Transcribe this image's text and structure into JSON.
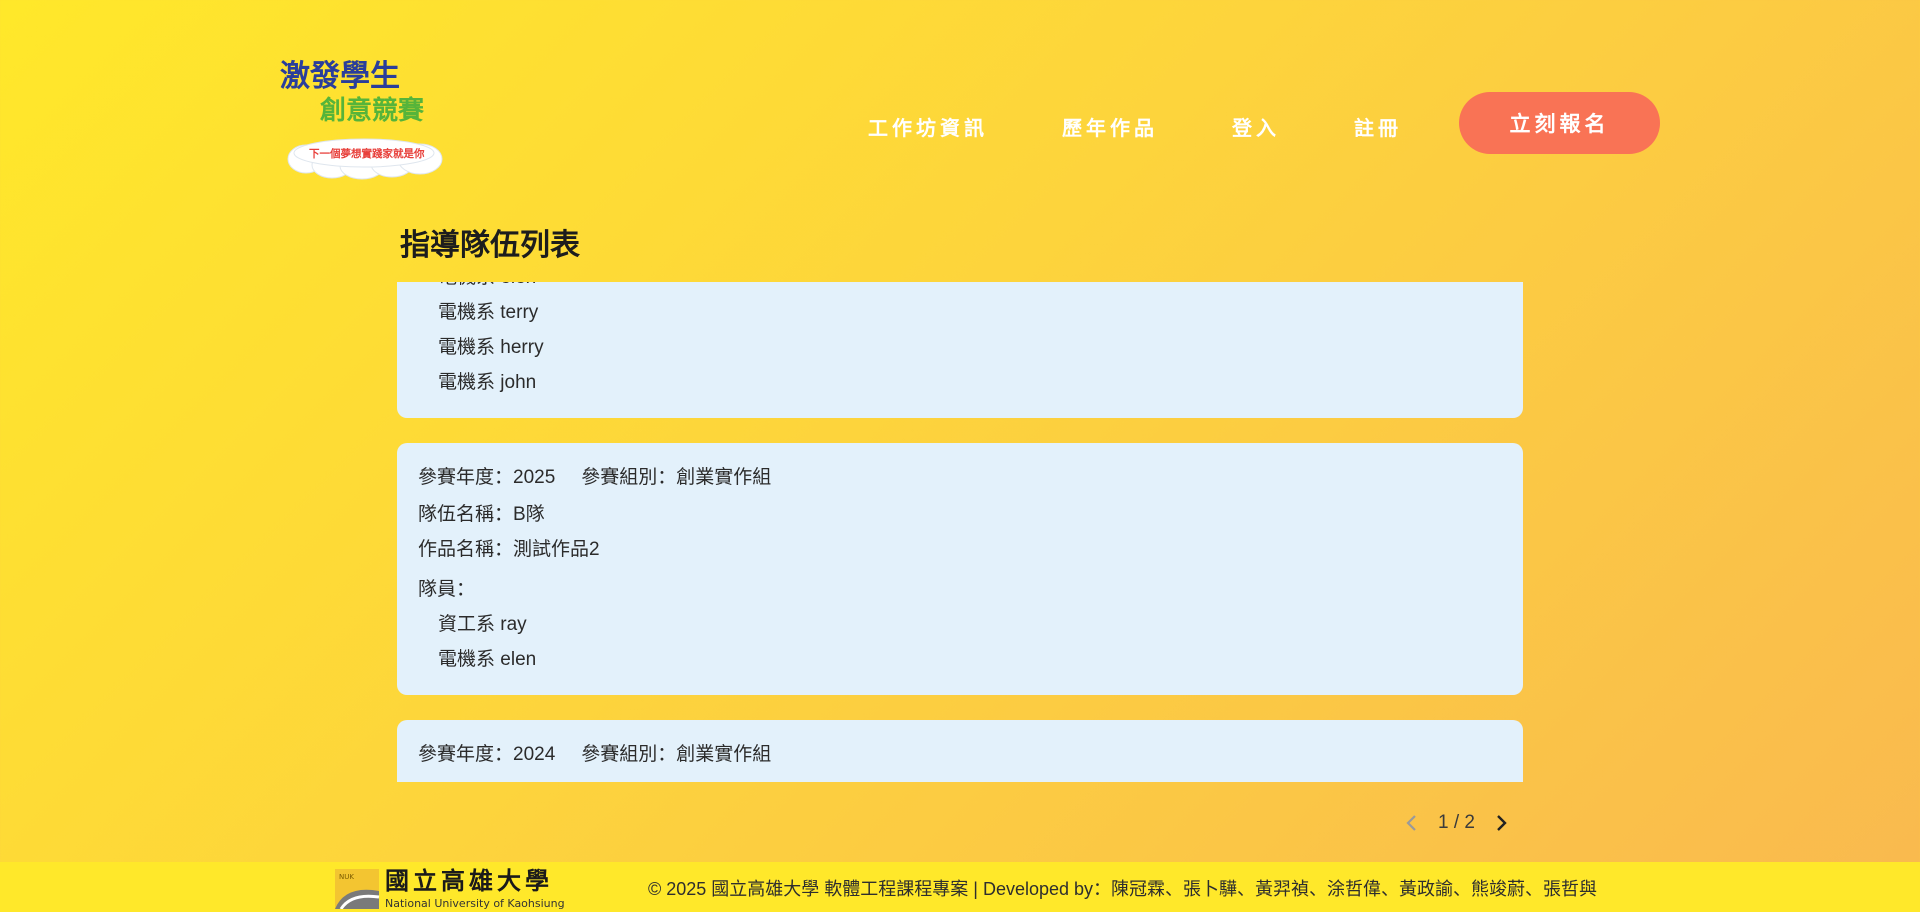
{
  "logo": {
    "line1": "激發學生",
    "line2": "創意競賽",
    "tagline": "下一個夢想實踐家就是你"
  },
  "nav": {
    "items": [
      "工作坊資訊",
      "歷年作品",
      "登入",
      "註冊"
    ],
    "cta": "立刻報名"
  },
  "page": {
    "title": "指導隊伍列表"
  },
  "teams": [
    {
      "members": [
        "電機系 elen",
        "電機系 terry",
        "電機系 herry",
        "電機系 john"
      ]
    },
    {
      "year_label": "參賽年度：2025",
      "group_label": "參賽組別：創業實作組",
      "team_label": "隊伍名稱：B隊",
      "work_label": "作品名稱：測試作品2",
      "members_label": "隊員：",
      "members": [
        "資工系 ray",
        "電機系 elen"
      ]
    },
    {
      "year_label": "參賽年度：2024",
      "group_label": "參賽組別：創業實作組"
    }
  ],
  "pagination": {
    "text": "1 / 2"
  },
  "footer": {
    "logo_cn": "國立高雄大學",
    "logo_en": "National University of Kaohsiung",
    "copyright": "© 2025 國立高雄大學 軟體工程課程專案 | Developed by：陳冠霖、張卜驊、黃羿禎、涂哲偉、黃政諭、熊竣蔚、張哲與"
  },
  "colors": {
    "cta": "#f97355",
    "card": "#e3f1fb",
    "footer": "#ffe82a"
  }
}
